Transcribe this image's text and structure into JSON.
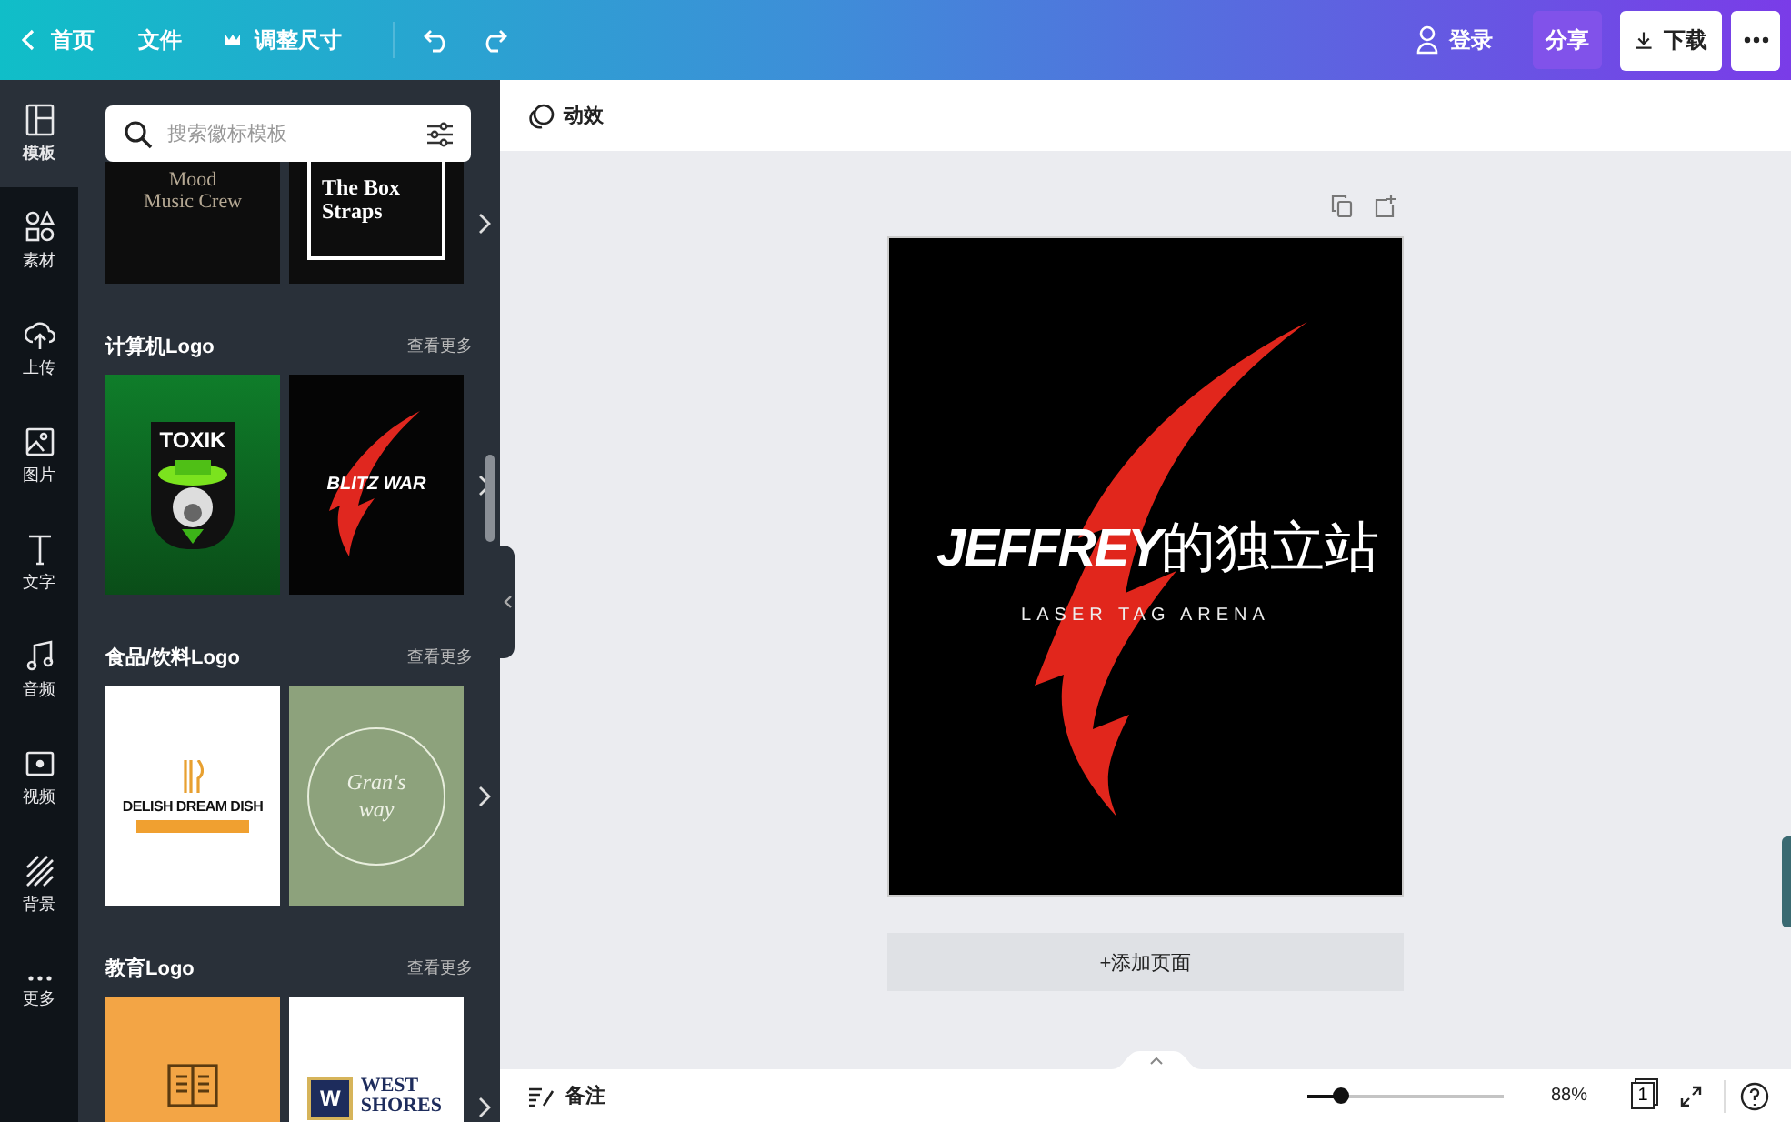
{
  "topbar": {
    "left": [
      {
        "kind": "home",
        "label": "首页"
      },
      {
        "kind": "file",
        "label": "文件"
      },
      {
        "kind": "resize",
        "label": "调整尺寸"
      }
    ],
    "login": "登录",
    "share": "分享",
    "download": "下载"
  },
  "rail": [
    {
      "kind": "template",
      "label": "模板",
      "selected": true
    },
    {
      "kind": "elements",
      "label": "素材",
      "selected": false
    },
    {
      "kind": "upload",
      "label": "上传",
      "selected": false
    },
    {
      "kind": "photo",
      "label": "图片",
      "selected": false
    },
    {
      "kind": "text",
      "label": "文字",
      "selected": false
    },
    {
      "kind": "audio",
      "label": "音频",
      "selected": false
    },
    {
      "kind": "video",
      "label": "视频",
      "selected": false
    },
    {
      "kind": "background",
      "label": "背景",
      "selected": false
    },
    {
      "kind": "more",
      "label": "更多",
      "selected": false
    }
  ],
  "search": {
    "placeholder": "搜索徽标模板"
  },
  "sections": [
    {
      "templates": [
        {
          "kind": "mood",
          "texts": [
            "Mood",
            "Music Crew"
          ]
        },
        {
          "kind": "box",
          "texts": [
            "The Box",
            "Straps"
          ]
        }
      ]
    },
    {
      "heading": "计算机Logo",
      "more": "查看更多",
      "templates": [
        {
          "kind": "toxik",
          "texts": [
            "TOXIK"
          ]
        },
        {
          "kind": "blitz",
          "texts": [
            "BLITZ WAR"
          ]
        }
      ]
    },
    {
      "heading": "食品/饮料Logo",
      "more": "查看更多",
      "templates": [
        {
          "kind": "delish",
          "texts": [
            "DELISH DREAM DISH"
          ]
        },
        {
          "kind": "gran",
          "texts": [
            "Gran's",
            "way"
          ]
        }
      ]
    },
    {
      "heading": "教育Logo",
      "more": "查看更多",
      "templates": [
        {
          "kind": "book"
        },
        {
          "kind": "west",
          "texts": [
            "W",
            "WEST",
            "SHORES"
          ]
        }
      ]
    }
  ],
  "toolbar": {
    "animate": "动效"
  },
  "design": {
    "title_latin": "JEFFREY",
    "title_cjk": "的独立站",
    "subtitle": "LASER TAG ARENA"
  },
  "add_page": "+添加页面",
  "bottom": {
    "notes": "备注",
    "zoom": {
      "level": 0.17,
      "reading": "88%"
    },
    "page_count": "1"
  }
}
